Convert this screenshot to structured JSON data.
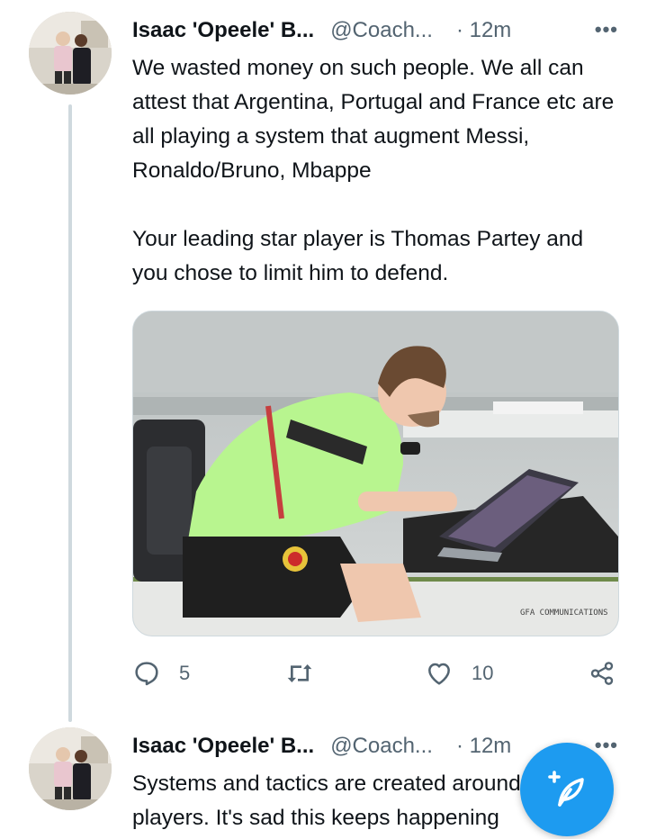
{
  "tweet1": {
    "author_name": "Isaac 'Opeele' B...",
    "handle": "@Coach...",
    "time": "· 12m",
    "more": "•••",
    "text": "We wasted money on such people. We all can attest that Argentina, Portugal and France etc are all playing a system that augment Messi, Ronaldo/Bruno, Mbappe\n\nYour leading star player is Thomas Partey and you chose to limit him to defend.",
    "media": {
      "watermark": "GFA COMMUNICATIONS"
    },
    "actions": {
      "reply_count": "5",
      "retweet_count": "",
      "like_count": "10"
    }
  },
  "tweet2": {
    "author_name": "Isaac 'Opeele' B...",
    "handle": "@Coach...",
    "time": "· 12m",
    "more": "•••",
    "text": "Systems and tactics are created around star players. It's sad this keeps happening"
  },
  "icons": {
    "reply": "reply-icon",
    "retweet": "retweet-icon",
    "like": "heart-icon",
    "share": "share-icon",
    "compose": "compose-tweet-icon",
    "more": "more-icon"
  },
  "colors": {
    "accent": "#1d9bf0",
    "secondary_text": "#536471",
    "thread_line": "#cfd9de"
  }
}
